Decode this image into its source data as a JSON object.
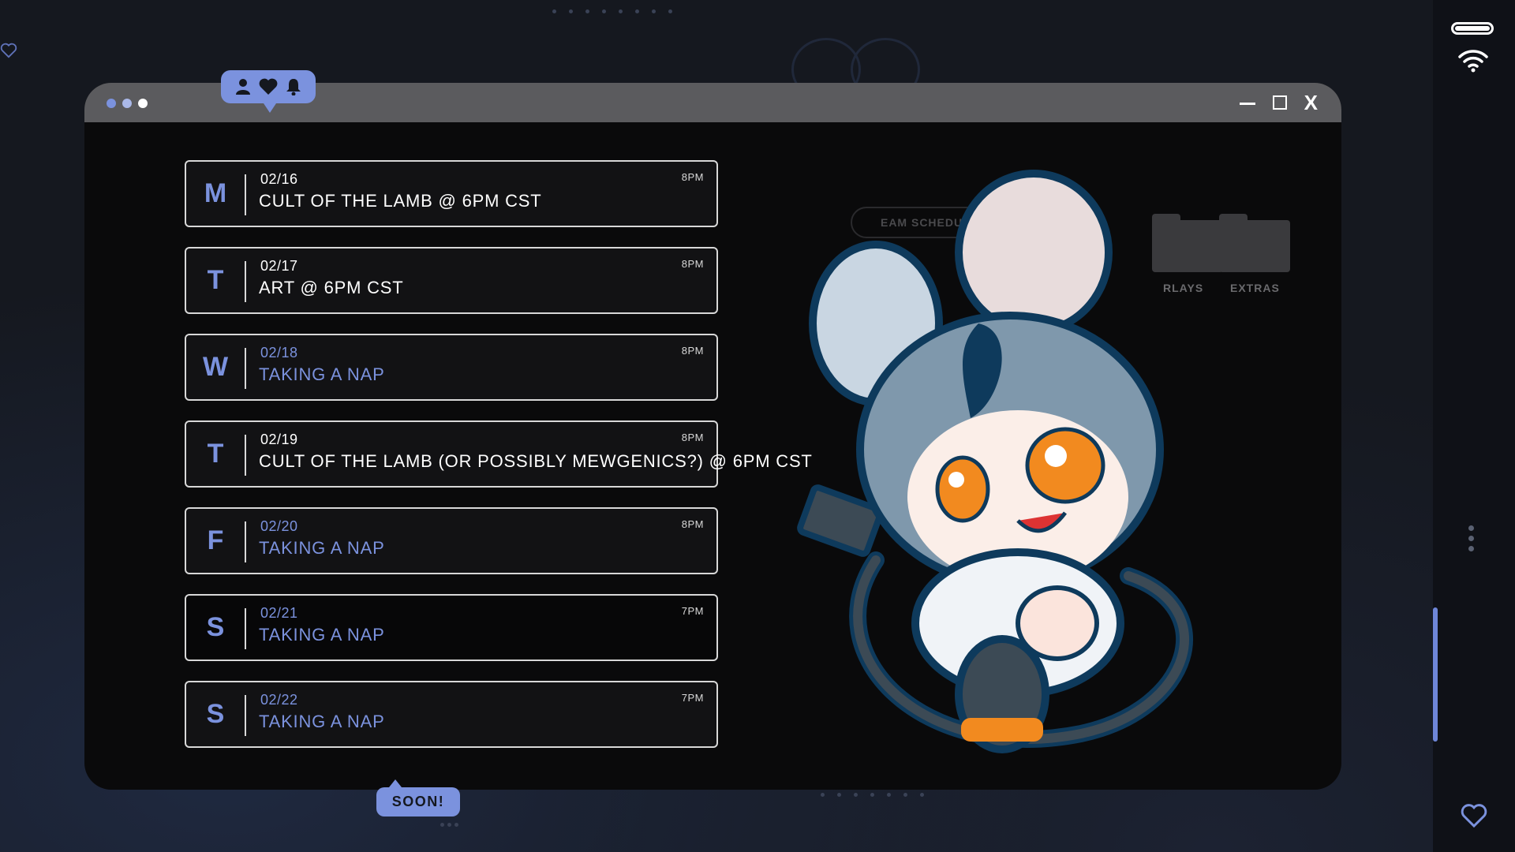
{
  "window": {
    "title_dots": [
      "#7b92de",
      "#aab8e8",
      "#ffffff"
    ],
    "controls": {
      "close_label": "X"
    }
  },
  "notification_bubble": {
    "icons": [
      "user-icon",
      "heart-icon",
      "bell-icon"
    ]
  },
  "schedule": [
    {
      "day": "M",
      "date": "02/16",
      "event": "CULT OF THE LAMB @ 6PM CST",
      "time": "8PM",
      "highlight": true
    },
    {
      "day": "T",
      "date": "02/17",
      "event": "ART @ 6PM CST",
      "time": "8PM",
      "highlight": true
    },
    {
      "day": "W",
      "date": "02/18",
      "event": "TAKING A NAP",
      "time": "8PM",
      "highlight": false
    },
    {
      "day": "T",
      "date": "02/19",
      "event": "CULT OF THE LAMB (OR POSSIBLY MEWGENICS?) @ 6PM CST",
      "time": "8PM",
      "highlight": true
    },
    {
      "day": "F",
      "date": "02/20",
      "event": "TAKING A NAP",
      "time": "8PM",
      "highlight": false
    },
    {
      "day": "S",
      "date": "02/21",
      "event": "TAKING A NAP",
      "time": "7PM",
      "highlight": false
    },
    {
      "day": "S",
      "date": "02/22",
      "event": "TAKING A NAP",
      "time": "7PM",
      "highlight": false
    }
  ],
  "background_ui": {
    "stream_pill": "EAM SCHEDULE",
    "folders": [
      "RLAYS",
      "EXTRAS"
    ]
  },
  "soon_button": "SOON!",
  "colors": {
    "accent": "#7b92de",
    "window_bg": "#0a0a0b",
    "titlebar": "#5b5b5e"
  }
}
